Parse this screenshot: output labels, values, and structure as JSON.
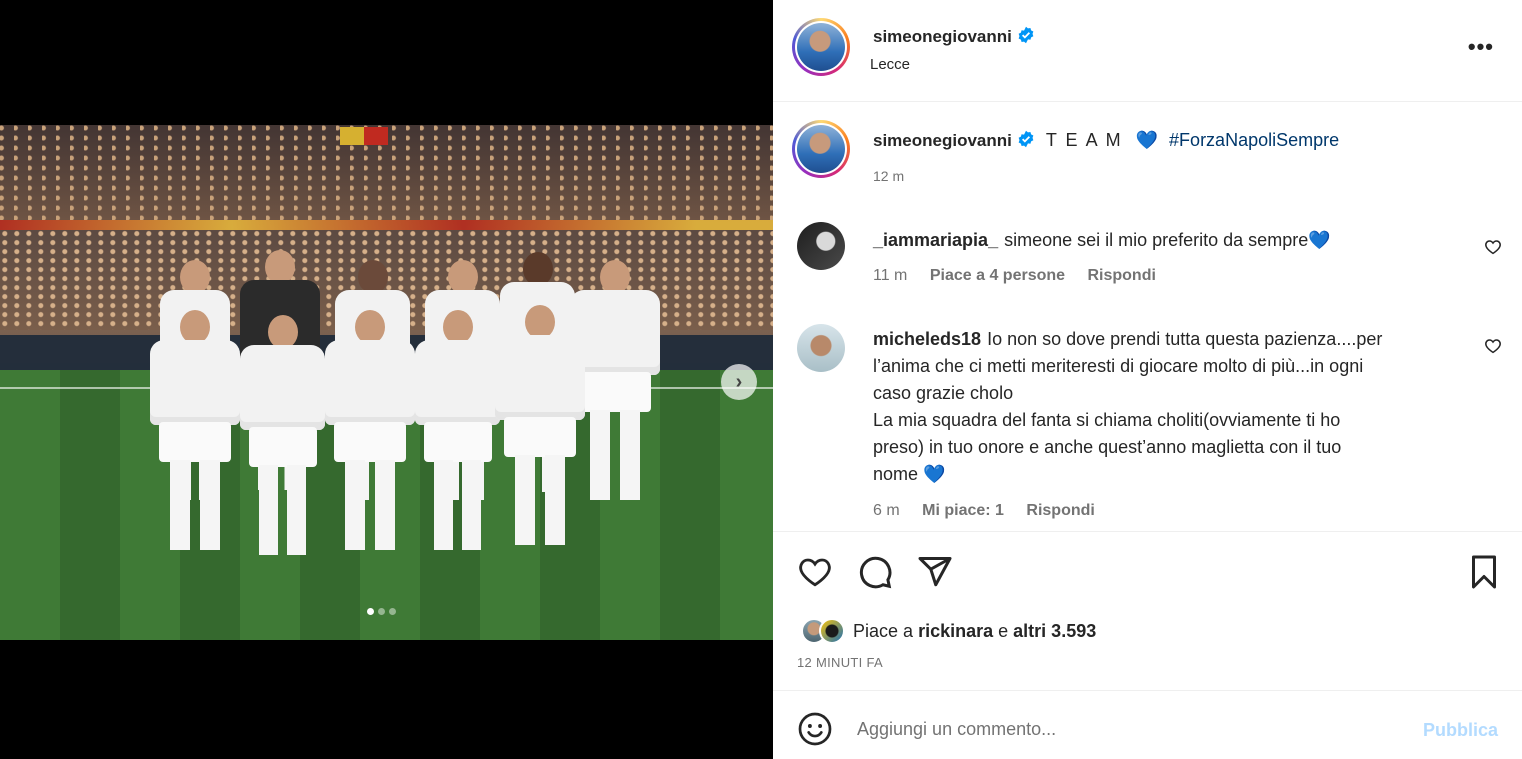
{
  "post": {
    "username": "simeonegiovanni",
    "location": "Lecce",
    "more_icon": "more-horizontal-icon",
    "media": {
      "carousel_index": 1,
      "carousel_total": 3,
      "next_icon": "chevron-right-icon"
    }
  },
  "caption": {
    "username": "simeonegiovanni",
    "text": "T E A M",
    "emoji": "💙",
    "hashtag": "#ForzaNapoliSempre",
    "time": "12 m"
  },
  "comments": [
    {
      "username": "_iammariapia_",
      "text": "simeone sei il mio preferito da sempre💙",
      "time": "11 m",
      "likes": "Piace a 4 persone",
      "reply": "Rispondi"
    },
    {
      "username": "micheleds18",
      "text_lines": [
        "Io non so dove prendi tutta questa pazienza....per",
        "l’anima che ci metti meriteresti di giocare molto di più...in ogni",
        "caso grazie cholo",
        "La mia squadra del fanta si chiama choliti(ovviamente ti ho",
        "preso) in tuo onore e anche quest’anno maglietta con il tuo",
        "nome 💙"
      ],
      "time": "6 m",
      "likes": "Mi piace: 1",
      "reply": "Rispondi"
    }
  ],
  "actions": {
    "liked_by_prefix": "Piace a",
    "liked_by_user": "rickinara",
    "liked_by_join": "e",
    "liked_by_others": "altri 3.593",
    "time_ago": "12 MINUTI FA"
  },
  "add_comment": {
    "placeholder": "Aggiungi un commento...",
    "publish_label": "Pubblica"
  },
  "colors": {
    "verified": "#0095f6",
    "hashtag": "#00376b",
    "muted": "#737373",
    "publish_disabled": "#b3dbff"
  }
}
